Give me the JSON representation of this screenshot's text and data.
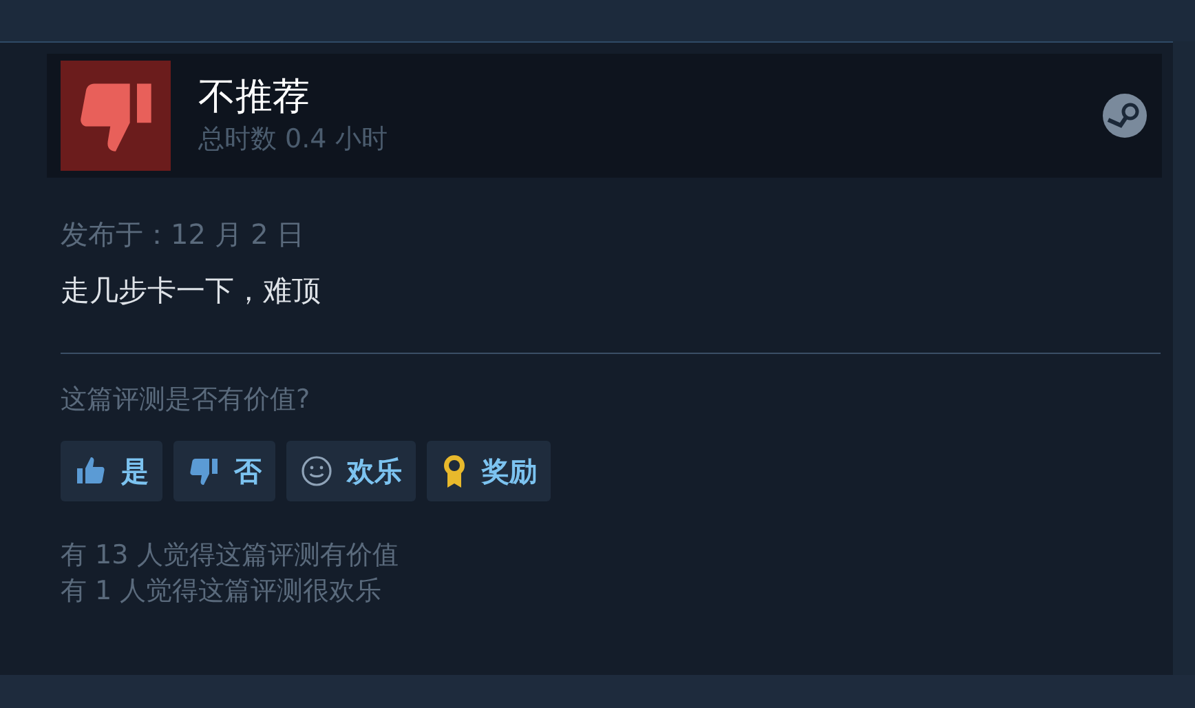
{
  "review": {
    "verdict": "不推荐",
    "recommended": false,
    "playtime": "总时数 0.4 小时",
    "posted": "发布于：12 月 2 日",
    "body": "走几步卡一下，难顶"
  },
  "helpful": {
    "question": "这篇评测是否有价值?",
    "buttons": [
      {
        "kind": "yes",
        "label": "是"
      },
      {
        "kind": "no",
        "label": "否"
      },
      {
        "kind": "funny",
        "label": "欢乐"
      },
      {
        "kind": "award",
        "label": "奖励"
      }
    ],
    "stats": [
      "有 13 人觉得这篇评测有价值",
      "有 1 人觉得这篇评测很欢乐"
    ]
  }
}
